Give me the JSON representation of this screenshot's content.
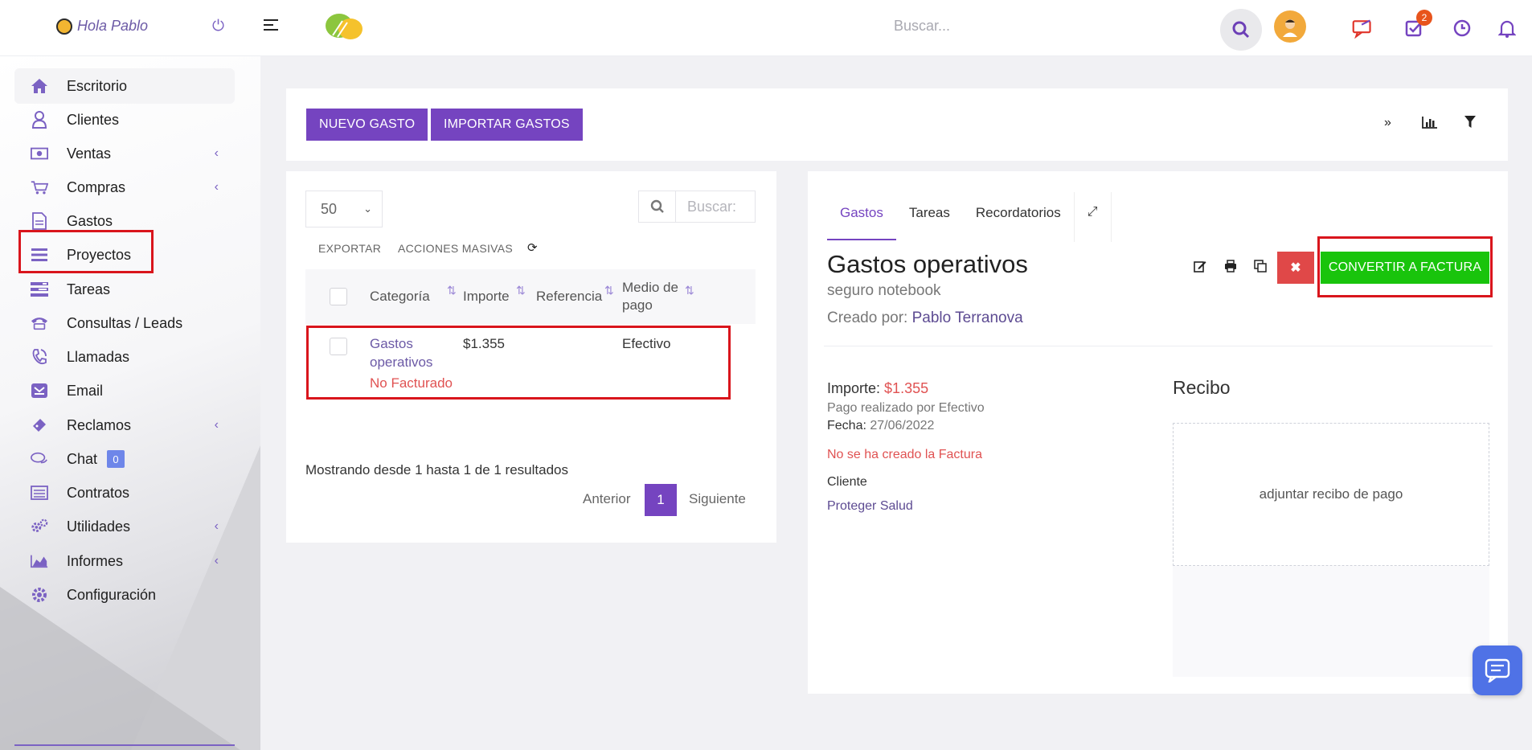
{
  "topbar": {
    "greeting": "Hola Pablo",
    "search_placeholder": "Buscar...",
    "tasks_badge": "2"
  },
  "sidebar": {
    "items": [
      {
        "label": "Escritorio",
        "icon": "home-icon"
      },
      {
        "label": "Clientes",
        "icon": "user-icon"
      },
      {
        "label": "Ventas",
        "icon": "money-icon"
      },
      {
        "label": "Compras",
        "icon": "cart-icon"
      },
      {
        "label": "Gastos",
        "icon": "file-icon"
      },
      {
        "label": "Proyectos",
        "icon": "bars-icon"
      },
      {
        "label": "Tareas",
        "icon": "tasks-icon"
      },
      {
        "label": "Consultas / Leads",
        "icon": "phone-icon"
      },
      {
        "label": "Llamadas",
        "icon": "call-icon"
      },
      {
        "label": "Email",
        "icon": "envelope-icon"
      },
      {
        "label": "Reclamos",
        "icon": "ticket-icon"
      },
      {
        "label": "Chat",
        "icon": "chat-icon",
        "badge": "0"
      },
      {
        "label": "Contratos",
        "icon": "contract-icon"
      },
      {
        "label": "Utilidades",
        "icon": "cogs-icon"
      },
      {
        "label": "Informes",
        "icon": "chart-area-icon"
      },
      {
        "label": "Configuración",
        "icon": "gear-icon"
      }
    ]
  },
  "toolbar": {
    "new_label": "NUEVO GASTO",
    "import_label": "IMPORTAR GASTOS"
  },
  "list": {
    "page_size": "50",
    "search_placeholder": "Buscar:",
    "export_label": "EXPORTAR",
    "bulk_label": "ACCIONES MASIVAS",
    "columns": [
      "Categoría",
      "Importe",
      "Referencia",
      "Medio de pago"
    ],
    "rows": [
      {
        "category": "Gastos operativos",
        "status": "No Facturado",
        "amount": "$1.355",
        "reference": "",
        "payment": "Efectivo"
      }
    ],
    "showing": "Mostrando desde 1 hasta 1 de 1 resultados",
    "prev": "Anterior",
    "page": "1",
    "next": "Siguiente"
  },
  "detail": {
    "tabs": [
      "Gastos",
      "Tareas",
      "Recordatorios"
    ],
    "title": "Gastos operativos",
    "subtitle": "seguro notebook",
    "created_by_label": "Creado por:",
    "created_by": "Pablo Terranova",
    "convert_label": "CONVERTIR A FACTURA",
    "amount_label": "Importe:",
    "amount": "$1.355",
    "paid_by": "Pago realizado por Efectivo",
    "date_label": "Fecha:",
    "date": "27/06/2022",
    "invoice_status": "No se ha creado la Factura",
    "client_label": "Cliente",
    "client": "Proteger Salud",
    "receipt_title": "Recibo",
    "receipt_drop": "adjuntar recibo de pago"
  },
  "colors": {
    "accent": "#7544c0",
    "convert": "#19c40c",
    "danger": "#e04848",
    "highlight": "#d9151c"
  }
}
